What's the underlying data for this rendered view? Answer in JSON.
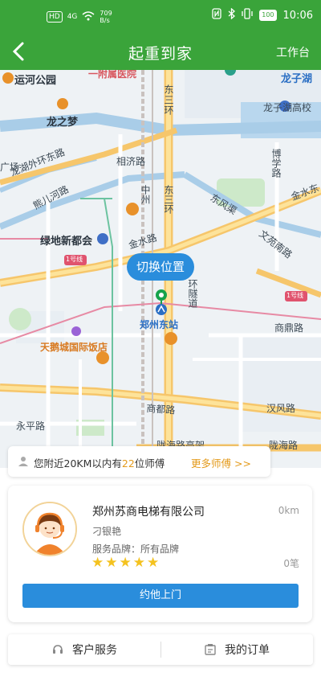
{
  "status_bar": {
    "net_speed": "709",
    "net_unit": "B/s",
    "hd": "HD",
    "signal": "4G",
    "battery": "100",
    "time": "10:06"
  },
  "navbar": {
    "title": "起重到家",
    "workbench": "工作台"
  },
  "map": {
    "labels": {
      "yunhe_park": "运河公园",
      "hospital": "一附属医院",
      "longzihu": "龙子湖",
      "longzhimeng": "龙之梦",
      "longzihu_school": "龙子湖高校",
      "dongsanhuan1": "东三环",
      "guangchang": "广场",
      "longhu_waihuan": "龙湖外环东路",
      "xiangcheng": "相济路",
      "boxue": "博学路",
      "zhongzhou": "中州",
      "dongsanhuan2": "东三环",
      "dongfeng": "东风渠",
      "jinshui_dong": "金水东",
      "xiongerhe": "熊儿河路",
      "ludi": "绿地新都会",
      "jinshui": "金水路",
      "wenhua": "文苑南路",
      "line1_left": "1号线",
      "line1_right": "1号线",
      "tunnel": "环隧道",
      "zhengzhou_east": "郑州东站",
      "shangding": "商鼎路",
      "tiane_hotel": "天鹅城国际饭店",
      "shangdu": "商都路",
      "hanfeng": "汉风路",
      "yongping": "永平路",
      "longhai_elevated": "陇海路高架",
      "longhai": "陇海路"
    },
    "switch_location": "切换位置"
  },
  "nearby": {
    "prefix": "您附近20KM以内有",
    "count": "22",
    "suffix": "位师傅",
    "more": "更多师傅 >>"
  },
  "master_card": {
    "company": "郑州苏商电梯有限公司",
    "distance": "0km",
    "name": "刁银艳",
    "brand": "服务品牌：所有品牌",
    "rating": 5,
    "orders": "0笔",
    "book_button": "约他上门"
  },
  "bottom_bar": {
    "customer_service": "客户服务",
    "my_orders": "我的订单"
  },
  "colors": {
    "brand_green": "#3aa43a",
    "action_blue": "#2a8ddc",
    "accent_orange": "#e39a1b",
    "star_yellow": "#f4c21f"
  }
}
